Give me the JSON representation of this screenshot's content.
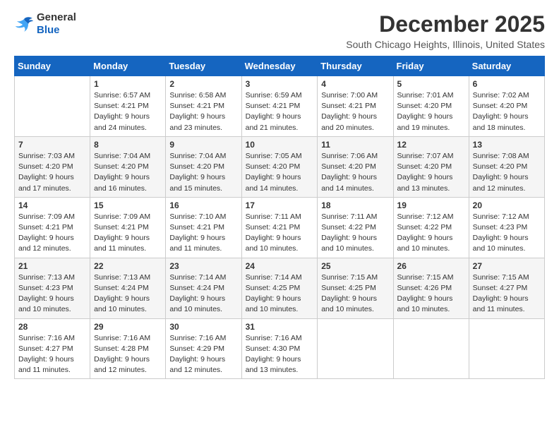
{
  "header": {
    "logo_general": "General",
    "logo_blue": "Blue",
    "month": "December 2025",
    "location": "South Chicago Heights, Illinois, United States"
  },
  "weekdays": [
    "Sunday",
    "Monday",
    "Tuesday",
    "Wednesday",
    "Thursday",
    "Friday",
    "Saturday"
  ],
  "weeks": [
    [
      {
        "day": "",
        "info": ""
      },
      {
        "day": "1",
        "info": "Sunrise: 6:57 AM\nSunset: 4:21 PM\nDaylight: 9 hours\nand 24 minutes."
      },
      {
        "day": "2",
        "info": "Sunrise: 6:58 AM\nSunset: 4:21 PM\nDaylight: 9 hours\nand 23 minutes."
      },
      {
        "day": "3",
        "info": "Sunrise: 6:59 AM\nSunset: 4:21 PM\nDaylight: 9 hours\nand 21 minutes."
      },
      {
        "day": "4",
        "info": "Sunrise: 7:00 AM\nSunset: 4:21 PM\nDaylight: 9 hours\nand 20 minutes."
      },
      {
        "day": "5",
        "info": "Sunrise: 7:01 AM\nSunset: 4:20 PM\nDaylight: 9 hours\nand 19 minutes."
      },
      {
        "day": "6",
        "info": "Sunrise: 7:02 AM\nSunset: 4:20 PM\nDaylight: 9 hours\nand 18 minutes."
      }
    ],
    [
      {
        "day": "7",
        "info": "Sunrise: 7:03 AM\nSunset: 4:20 PM\nDaylight: 9 hours\nand 17 minutes."
      },
      {
        "day": "8",
        "info": "Sunrise: 7:04 AM\nSunset: 4:20 PM\nDaylight: 9 hours\nand 16 minutes."
      },
      {
        "day": "9",
        "info": "Sunrise: 7:04 AM\nSunset: 4:20 PM\nDaylight: 9 hours\nand 15 minutes."
      },
      {
        "day": "10",
        "info": "Sunrise: 7:05 AM\nSunset: 4:20 PM\nDaylight: 9 hours\nand 14 minutes."
      },
      {
        "day": "11",
        "info": "Sunrise: 7:06 AM\nSunset: 4:20 PM\nDaylight: 9 hours\nand 14 minutes."
      },
      {
        "day": "12",
        "info": "Sunrise: 7:07 AM\nSunset: 4:20 PM\nDaylight: 9 hours\nand 13 minutes."
      },
      {
        "day": "13",
        "info": "Sunrise: 7:08 AM\nSunset: 4:20 PM\nDaylight: 9 hours\nand 12 minutes."
      }
    ],
    [
      {
        "day": "14",
        "info": "Sunrise: 7:09 AM\nSunset: 4:21 PM\nDaylight: 9 hours\nand 12 minutes."
      },
      {
        "day": "15",
        "info": "Sunrise: 7:09 AM\nSunset: 4:21 PM\nDaylight: 9 hours\nand 11 minutes."
      },
      {
        "day": "16",
        "info": "Sunrise: 7:10 AM\nSunset: 4:21 PM\nDaylight: 9 hours\nand 11 minutes."
      },
      {
        "day": "17",
        "info": "Sunrise: 7:11 AM\nSunset: 4:21 PM\nDaylight: 9 hours\nand 10 minutes."
      },
      {
        "day": "18",
        "info": "Sunrise: 7:11 AM\nSunset: 4:22 PM\nDaylight: 9 hours\nand 10 minutes."
      },
      {
        "day": "19",
        "info": "Sunrise: 7:12 AM\nSunset: 4:22 PM\nDaylight: 9 hours\nand 10 minutes."
      },
      {
        "day": "20",
        "info": "Sunrise: 7:12 AM\nSunset: 4:23 PM\nDaylight: 9 hours\nand 10 minutes."
      }
    ],
    [
      {
        "day": "21",
        "info": "Sunrise: 7:13 AM\nSunset: 4:23 PM\nDaylight: 9 hours\nand 10 minutes."
      },
      {
        "day": "22",
        "info": "Sunrise: 7:13 AM\nSunset: 4:24 PM\nDaylight: 9 hours\nand 10 minutes."
      },
      {
        "day": "23",
        "info": "Sunrise: 7:14 AM\nSunset: 4:24 PM\nDaylight: 9 hours\nand 10 minutes."
      },
      {
        "day": "24",
        "info": "Sunrise: 7:14 AM\nSunset: 4:25 PM\nDaylight: 9 hours\nand 10 minutes."
      },
      {
        "day": "25",
        "info": "Sunrise: 7:15 AM\nSunset: 4:25 PM\nDaylight: 9 hours\nand 10 minutes."
      },
      {
        "day": "26",
        "info": "Sunrise: 7:15 AM\nSunset: 4:26 PM\nDaylight: 9 hours\nand 10 minutes."
      },
      {
        "day": "27",
        "info": "Sunrise: 7:15 AM\nSunset: 4:27 PM\nDaylight: 9 hours\nand 11 minutes."
      }
    ],
    [
      {
        "day": "28",
        "info": "Sunrise: 7:16 AM\nSunset: 4:27 PM\nDaylight: 9 hours\nand 11 minutes."
      },
      {
        "day": "29",
        "info": "Sunrise: 7:16 AM\nSunset: 4:28 PM\nDaylight: 9 hours\nand 12 minutes."
      },
      {
        "day": "30",
        "info": "Sunrise: 7:16 AM\nSunset: 4:29 PM\nDaylight: 9 hours\nand 12 minutes."
      },
      {
        "day": "31",
        "info": "Sunrise: 7:16 AM\nSunset: 4:30 PM\nDaylight: 9 hours\nand 13 minutes."
      },
      {
        "day": "",
        "info": ""
      },
      {
        "day": "",
        "info": ""
      },
      {
        "day": "",
        "info": ""
      }
    ]
  ]
}
